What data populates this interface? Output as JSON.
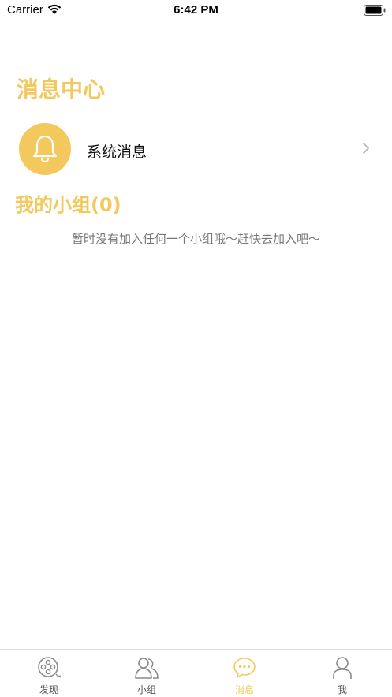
{
  "status_bar": {
    "carrier": "Carrier",
    "time": "6:42 PM"
  },
  "page": {
    "title": "消息中心"
  },
  "system_message": {
    "label": "系统消息",
    "icon": "bell-icon"
  },
  "groups": {
    "title": "我的小组(0)",
    "empty_text": "暂时没有加入任何一个小组哦～赶快去加入吧～"
  },
  "tabbar": {
    "active_color": "#F3C95D",
    "items": [
      {
        "label": "发现",
        "icon": "film-reel-icon",
        "active": false
      },
      {
        "label": "小组",
        "icon": "group-icon",
        "active": false
      },
      {
        "label": "消息",
        "icon": "chat-bubble-icon",
        "active": true
      },
      {
        "label": "我",
        "icon": "person-icon",
        "active": false
      }
    ]
  },
  "colors": {
    "accent": "#F3C95D",
    "secondary_text": "#777777"
  }
}
